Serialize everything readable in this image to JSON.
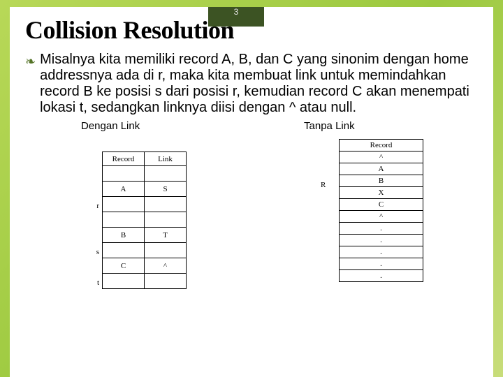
{
  "page_number": "3",
  "title": "Collision Resolution",
  "bullet_glyph": "❧",
  "body": "Misalnya kita memiliki record A, B, dan C yang sinonim dengan home addressnya ada di r, maka kita membuat link untuk memindahkan record B ke posisi s dari posisi r, kemudian  record C akan menempati lokasi t, sedangkan linknya diisi dengan ^ atau null.",
  "left": {
    "heading": "Dengan Link",
    "headers": {
      "c1": "Record",
      "c2": "Link"
    },
    "rows": [
      {
        "label": "",
        "c1": "",
        "c2": ""
      },
      {
        "label": "r",
        "c1": "A",
        "c2": "S"
      },
      {
        "label": "",
        "c1": "",
        "c2": ""
      },
      {
        "label": "",
        "c1": "",
        "c2": ""
      },
      {
        "label": "s",
        "c1": "B",
        "c2": "T"
      },
      {
        "label": "",
        "c1": "",
        "c2": ""
      },
      {
        "label": "t",
        "c1": "C",
        "c2": "^"
      },
      {
        "label": "",
        "c1": "",
        "c2": ""
      }
    ]
  },
  "right": {
    "heading": "Tanpa Link",
    "header": "Record",
    "r_label": "R",
    "rows": [
      "^",
      "A",
      "B",
      "X",
      "C",
      "^",
      ".",
      ".",
      ".",
      ".",
      "."
    ]
  }
}
